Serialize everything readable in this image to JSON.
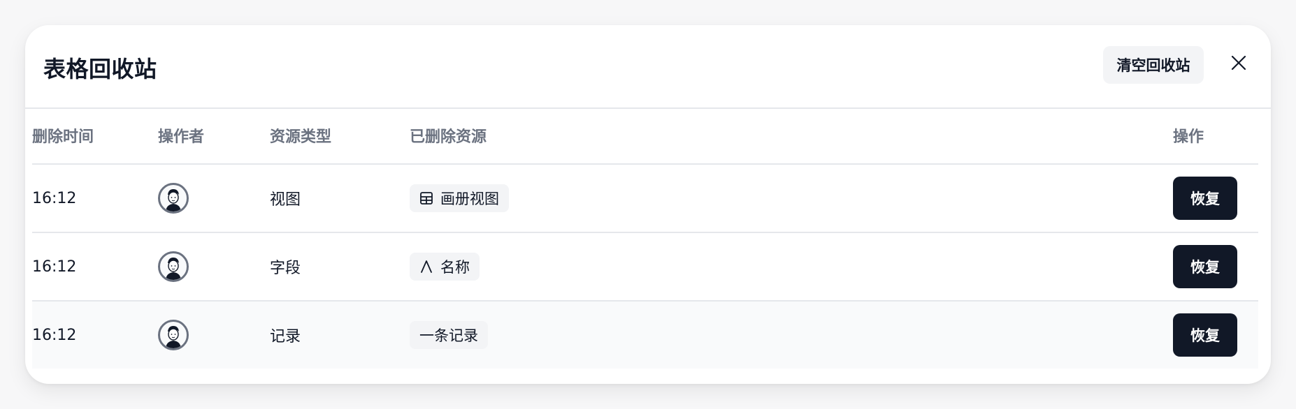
{
  "dialog": {
    "title": "表格回收站",
    "clear_label": "清空回收站",
    "close_icon": "close-icon"
  },
  "table": {
    "headers": [
      "删除时间",
      "操作者",
      "资源类型",
      "已删除资源",
      "操作"
    ],
    "rows": [
      {
        "time": "16:12",
        "operator_icon": "avatar",
        "type": "视图",
        "resource_icon": "gallery-icon",
        "resource": "画册视图",
        "action": "恢复"
      },
      {
        "time": "16:12",
        "operator_icon": "avatar",
        "type": "字段",
        "resource_icon": "text-field-icon",
        "resource": "名称",
        "action": "恢复"
      },
      {
        "time": "16:12",
        "operator_icon": "avatar",
        "type": "记录",
        "resource_icon": "",
        "resource": "一条记录",
        "action": "恢复"
      }
    ]
  },
  "colors": {
    "primary": "#111827",
    "muted": "#6b7280",
    "chip_bg": "#f3f4f6",
    "border": "#e5e7eb"
  }
}
